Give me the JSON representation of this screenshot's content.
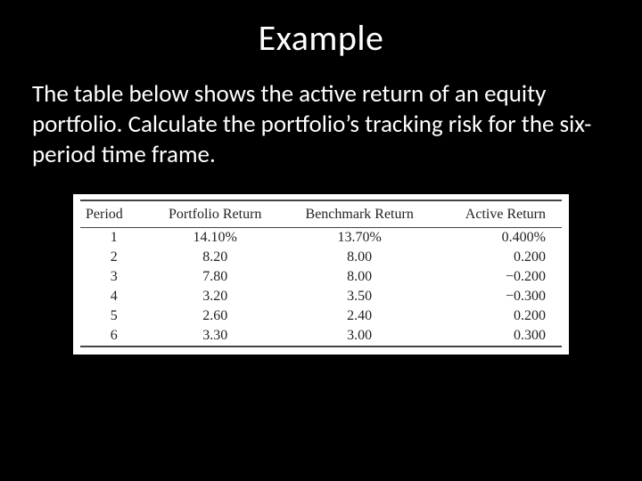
{
  "title": "Example",
  "body": "The table below shows the active return of an equity portfolio. Calculate the portfolio’s tracking risk for the six-period time frame.",
  "chart_data": {
    "type": "table",
    "columns": [
      "Period",
      "Portfolio Return",
      "Benchmark Return",
      "Active Return"
    ],
    "rows": [
      {
        "period": "1",
        "portfolio_return": "14.10%",
        "benchmark_return": "13.70%",
        "active_return": "0.400%"
      },
      {
        "period": "2",
        "portfolio_return": "8.20",
        "benchmark_return": "8.00",
        "active_return": "0.200"
      },
      {
        "period": "3",
        "portfolio_return": "7.80",
        "benchmark_return": "8.00",
        "active_return": "−0.200"
      },
      {
        "period": "4",
        "portfolio_return": "3.20",
        "benchmark_return": "3.50",
        "active_return": "−0.300"
      },
      {
        "period": "5",
        "portfolio_return": "2.60",
        "benchmark_return": "2.40",
        "active_return": "0.200"
      },
      {
        "period": "6",
        "portfolio_return": "3.30",
        "benchmark_return": "3.00",
        "active_return": "0.300"
      }
    ]
  }
}
